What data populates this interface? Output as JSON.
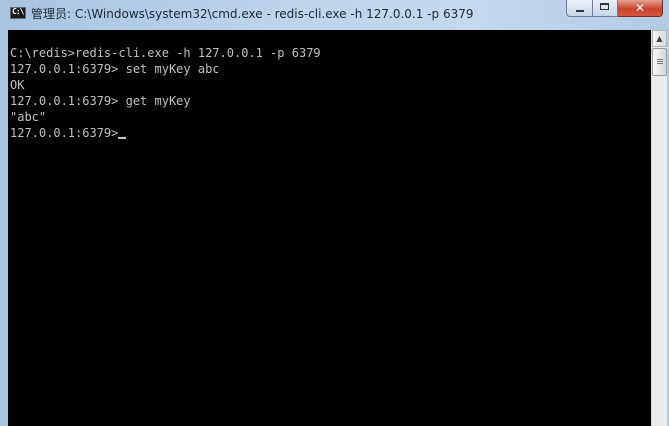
{
  "window": {
    "title": "管理员: C:\\Windows\\system32\\cmd.exe - redis-cli.exe  -h 127.0.0.1 -p 6379",
    "icon": "cmd-icon",
    "icon_text": "C:\\"
  },
  "controls": {
    "minimize_icon": "minimize-icon",
    "maximize_icon": "maximize-icon",
    "close_icon": "close-icon",
    "close_glyph": "✕"
  },
  "console": {
    "lines": [
      "C:\\redis>redis-cli.exe -h 127.0.0.1 -p 6379",
      "127.0.0.1:6379> set myKey abc",
      "OK",
      "127.0.0.1:6379> get myKey",
      "\"abc\"",
      "127.0.0.1:6379>"
    ]
  },
  "scrollbar": {
    "up_arrow": "▲"
  }
}
